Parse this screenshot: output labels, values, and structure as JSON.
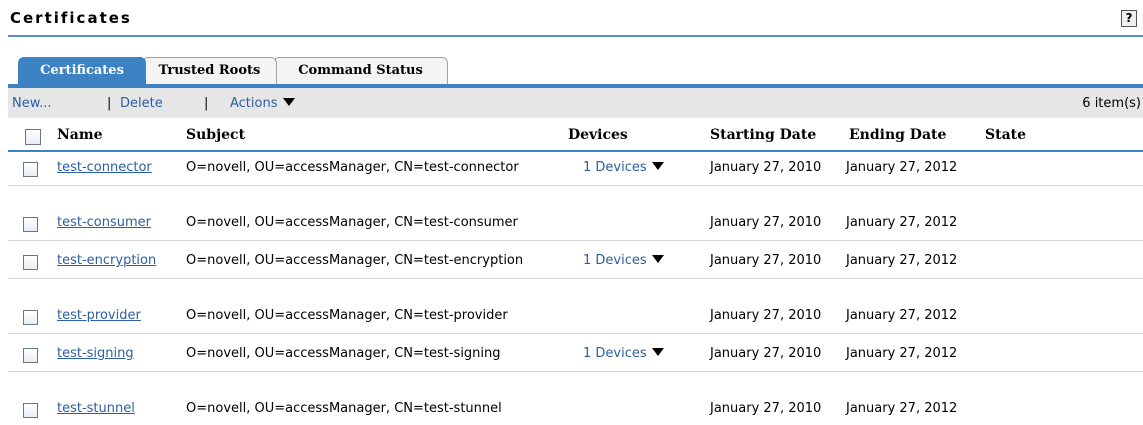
{
  "page": {
    "title": "Certificates",
    "help_label": "?"
  },
  "tabs": [
    {
      "label": "Certificates",
      "active": true
    },
    {
      "label": "Trusted Roots",
      "active": false
    },
    {
      "label": "Command Status",
      "active": false
    }
  ],
  "toolbar": {
    "new_label": "New...",
    "separator": "|",
    "delete_label": "Delete",
    "actions_label": "Actions",
    "item_count": "6 item(s)"
  },
  "table": {
    "columns": {
      "name": "Name",
      "subject": "Subject",
      "devices": "Devices",
      "start": "Starting Date",
      "end": "Ending Date",
      "state": "State"
    },
    "rows": [
      {
        "name": "test-connector",
        "subject": "O=novell, OU=accessManager, CN=test-connector",
        "devices": "1 Devices",
        "start": "January 27, 2010",
        "end": "January 27, 2012",
        "state": ""
      },
      {
        "name": "test-consumer",
        "subject": "O=novell, OU=accessManager, CN=test-consumer",
        "devices": "",
        "start": "January 27, 2010",
        "end": "January 27, 2012",
        "state": ""
      },
      {
        "name": "test-encryption",
        "subject": "O=novell, OU=accessManager, CN=test-encryption",
        "devices": "1 Devices",
        "start": "January 27, 2010",
        "end": "January 27, 2012",
        "state": ""
      },
      {
        "name": "test-provider",
        "subject": "O=novell, OU=accessManager, CN=test-provider",
        "devices": "",
        "start": "January 27, 2010",
        "end": "January 27, 2012",
        "state": ""
      },
      {
        "name": "test-signing",
        "subject": "O=novell, OU=accessManager, CN=test-signing",
        "devices": "1 Devices",
        "start": "January 27, 2010",
        "end": "January 27, 2012",
        "state": ""
      },
      {
        "name": "test-stunnel",
        "subject": "O=novell, OU=accessManager, CN=test-stunnel",
        "devices": "",
        "start": "January 27, 2010",
        "end": "January 27, 2012",
        "state": ""
      }
    ]
  }
}
